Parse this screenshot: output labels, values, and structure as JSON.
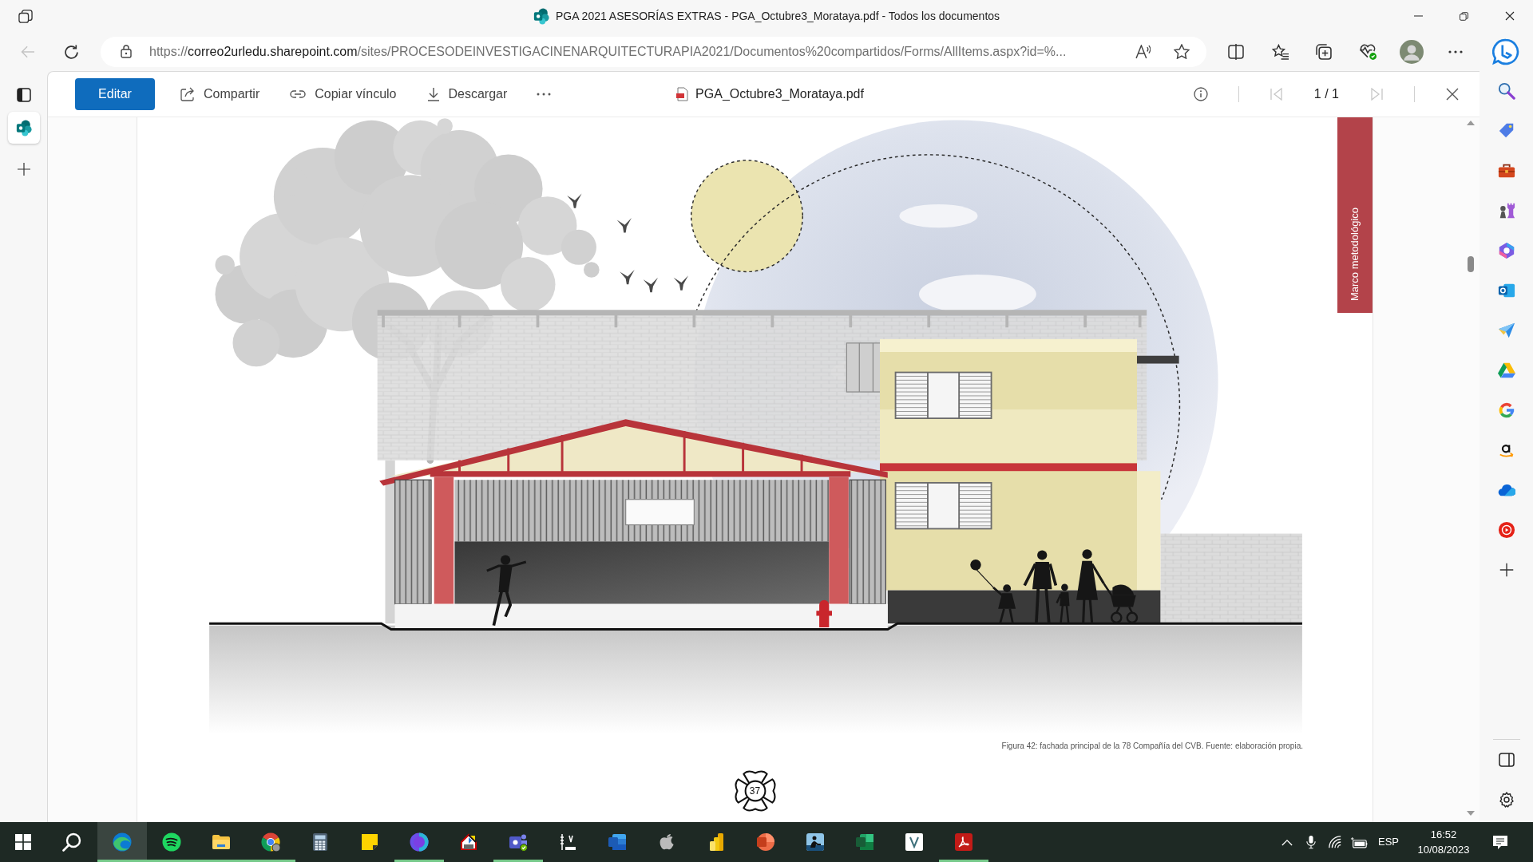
{
  "window": {
    "title": "PGA 2021 ASESORÍAS EXTRAS - PGA_Octubre3_Morataya.pdf - Todos los documentos"
  },
  "address_bar": {
    "scheme": "https://",
    "host": "correo2urledu.sharepoint.com",
    "path": "/sites/PROCESODEINVESTIGACINENARQUITECTURAPIA2021/Documentos%20compartidos/Forms/AllItems.aspx?id=%..."
  },
  "vertical_tabs": [
    {
      "selected": true
    }
  ],
  "viewer": {
    "edit_button": "Editar",
    "actions": [
      {
        "kind": "share",
        "label": "Compartir"
      },
      {
        "kind": "link",
        "label": "Copiar vínculo"
      },
      {
        "kind": "download",
        "label": "Descargar"
      }
    ],
    "file_name": "PGA_Octubre3_Morataya.pdf",
    "page_indicator": "1 / 1",
    "nav_buttons": [
      {
        "kind": "first",
        "disabled": true
      },
      {
        "kind": "last",
        "disabled": true
      }
    ]
  },
  "document": {
    "side_tab": "Marco metodológico",
    "caption": "Figura 42: fachada principal de la 78 Compañía del CVB. Fuente: elaboración propia.",
    "page_number": "37"
  },
  "sidebar": {
    "items": [
      {
        "kind": "search"
      },
      {
        "kind": "tag"
      },
      {
        "kind": "toolbox"
      },
      {
        "kind": "chess"
      },
      {
        "kind": "hexagon"
      },
      {
        "kind": "mail"
      },
      {
        "kind": "plane"
      },
      {
        "kind": "triangle"
      },
      {
        "kind": "g"
      },
      {
        "kind": "a"
      },
      {
        "kind": "cloud"
      },
      {
        "kind": "play"
      },
      {
        "kind": "add"
      }
    ]
  },
  "taskbar": {
    "apps": [
      {
        "kind": "edge",
        "running": true,
        "selected": true
      },
      {
        "kind": "spotify",
        "running": true,
        "selected": false
      },
      {
        "kind": "files",
        "running": true,
        "selected": false
      },
      {
        "kind": "chrome",
        "running": true,
        "selected": false
      },
      {
        "kind": "calculator",
        "running": false,
        "selected": false
      },
      {
        "kind": "notes",
        "running": false,
        "selected": false
      },
      {
        "kind": "canva",
        "running": true,
        "selected": false
      },
      {
        "kind": "frame",
        "running": false,
        "selected": false
      },
      {
        "kind": "teams",
        "running": true,
        "selected": false
      },
      {
        "kind": "ruler",
        "running": false,
        "selected": false
      },
      {
        "kind": "word",
        "running": false,
        "selected": false
      },
      {
        "kind": "apple",
        "running": false,
        "selected": false
      },
      {
        "kind": "bars",
        "running": false,
        "selected": false
      },
      {
        "kind": "slides",
        "running": false,
        "selected": false
      },
      {
        "kind": "reader",
        "running": false,
        "selected": false
      },
      {
        "kind": "sheet",
        "running": false,
        "selected": false
      },
      {
        "kind": "vmark",
        "running": false,
        "selected": false
      },
      {
        "kind": "acrobat",
        "running": true,
        "selected": false
      }
    ],
    "tray": {
      "language": "ESP",
      "time": "16:52",
      "date": "10/08/2023"
    }
  }
}
